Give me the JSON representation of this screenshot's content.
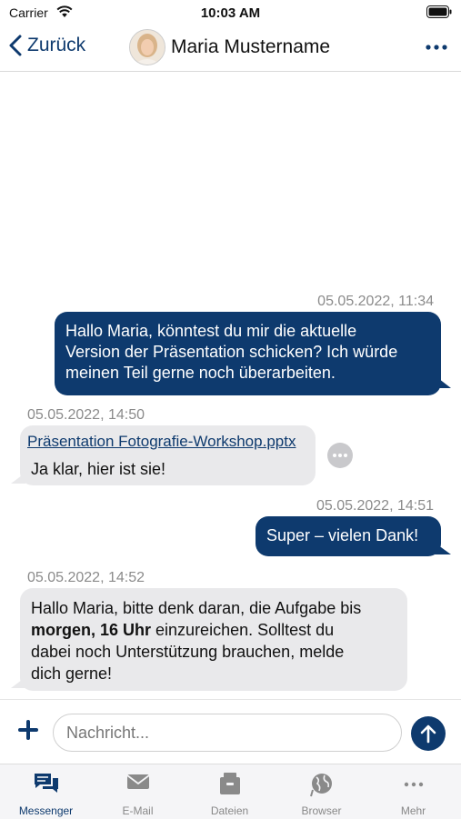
{
  "status_bar": {
    "carrier": "Carrier",
    "time": "10:03 AM"
  },
  "header": {
    "back_label": "Zurück",
    "contact_name": "Maria Mustername"
  },
  "messages": [
    {
      "direction": "outgoing",
      "timestamp": "05.05.2022, 11:34",
      "lines": [
        "Hallo Maria, könntest du mir die aktuelle",
        "Version der Präsentation schicken? Ich würde",
        "meinen Teil gerne noch überarbeiten."
      ]
    },
    {
      "direction": "incoming",
      "timestamp": "05.05.2022, 14:50",
      "attachment": "Präsentation Fotografie-Workshop.pptx",
      "text": "Ja klar, hier ist sie!"
    },
    {
      "direction": "outgoing",
      "timestamp": "05.05.2022, 14:51",
      "text": "Super – vielen Dank!"
    },
    {
      "direction": "incoming",
      "timestamp": "05.05.2022, 14:52",
      "line1": "Hallo Maria, bitte denk daran, die Aufgabe bis",
      "bold": "morgen, 16 Uhr",
      "line2_rest": " einzureichen. Solltest du",
      "line3": "dabei noch Unterstützung brauchen, melde",
      "line4": "dich gerne!"
    }
  ],
  "composer": {
    "placeholder": "Nachricht..."
  },
  "tabs": [
    {
      "label": "Messenger",
      "icon": "messenger-icon",
      "active": true
    },
    {
      "label": "E-Mail",
      "icon": "envelope-icon",
      "active": false
    },
    {
      "label": "Dateien",
      "icon": "files-icon",
      "active": false
    },
    {
      "label": "Browser",
      "icon": "globe-icon",
      "active": false
    },
    {
      "label": "Mehr",
      "icon": "more-dots-icon",
      "active": false
    }
  ],
  "colors": {
    "accent": "#0e3a6e",
    "incoming_bubble": "#e9e9eb",
    "timestamp": "#8b8b8b"
  }
}
